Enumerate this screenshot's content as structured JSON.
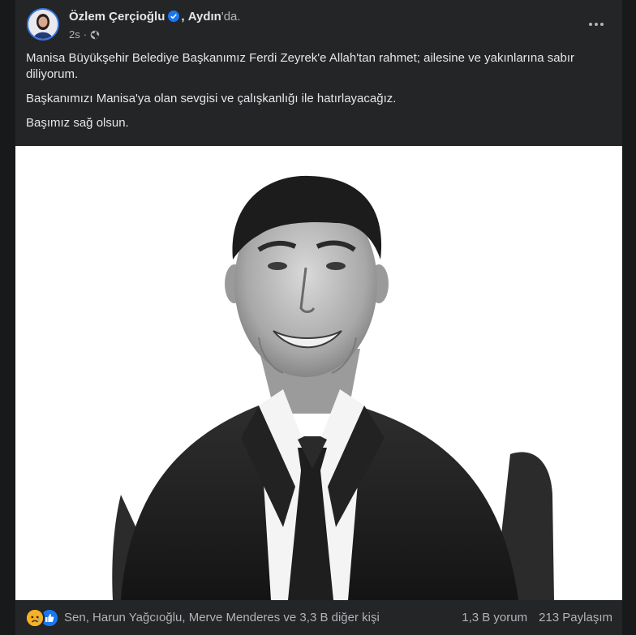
{
  "post": {
    "author": "Özlem Çerçioğlu",
    "separator": ",",
    "location": "Aydın",
    "location_suffix": "'da.",
    "time": "2s",
    "meta_separator": "·",
    "paragraphs": [
      "Manisa Büyükşehir Belediye Başkanımız Ferdi Zeyrek'e Allah'tan rahmet; ailesine ve yakınlarına sabır diliyorum.",
      "Başkanımızı Manisa'ya olan sevgisi ve çalışkanlığı ile hatırlayacağız.",
      "Başımız sağ olsun."
    ]
  },
  "footer": {
    "reactions_text": "Sen, Harun Yağcıoğlu, Merve Menderes ve 3,3 B diğer kişi",
    "comments": "1,3 B yorum",
    "shares": "213 Paylaşım"
  },
  "icons": {
    "verified": "verified-badge-icon",
    "globe": "globe-icon",
    "more": "more-dots-icon",
    "sad": "sad-reaction-icon",
    "like": "like-reaction-icon"
  },
  "colors": {
    "background": "#18191a",
    "card": "#242526",
    "primary_text": "#e4e6eb",
    "secondary_text": "#b0b3b8",
    "accent": "#1877f2"
  }
}
